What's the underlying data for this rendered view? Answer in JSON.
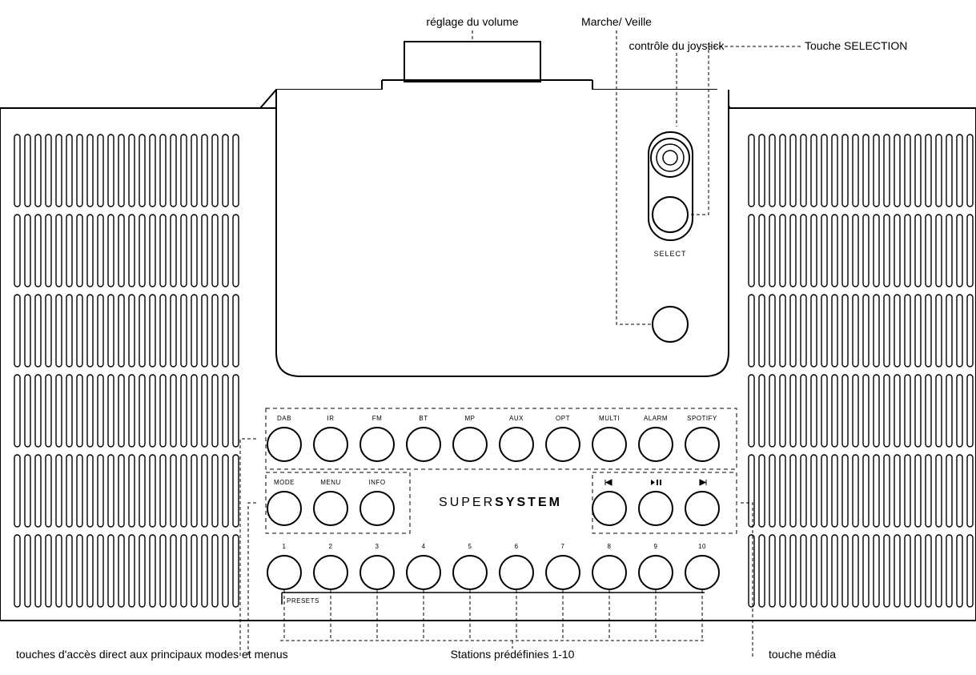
{
  "callouts": {
    "volume": "réglage du volume",
    "power": "Marche/ Veille",
    "joystick": "contrôle du joystick",
    "select": "Touche SELECTION",
    "direct": "touches d'accès direct aux principaux modes et menus",
    "presets": "Stations prédéfinies 1-10",
    "media": "touche média"
  },
  "selectLabel": "SELECT",
  "brand1": "SUPER",
  "brand2": "SYSTEM",
  "row1": [
    "DAB",
    "IR",
    "FM",
    "BT",
    "MP",
    "AUX",
    "OPT",
    "MULTI",
    "ALARM",
    "SPOTIFY"
  ],
  "row2left": [
    "MODE",
    "MENU",
    "INFO"
  ],
  "row2mediaIcons": [
    "prev",
    "playpause",
    "next"
  ],
  "presetNumbers": [
    "1",
    "2",
    "3",
    "4",
    "5",
    "6",
    "7",
    "8",
    "9",
    "10"
  ],
  "presetsLabel": "PRESETS"
}
